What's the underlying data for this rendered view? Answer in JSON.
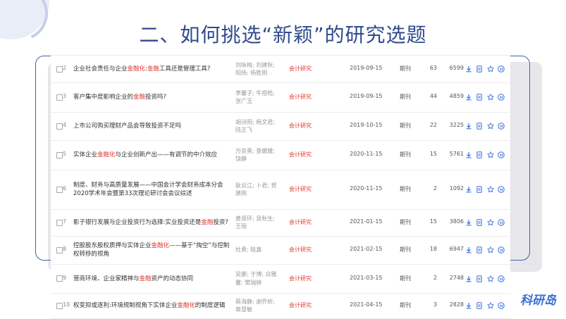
{
  "title": "二、如何挑选“新颖”的研究选题",
  "logo": "科研岛",
  "rows": [
    {
      "num": "2",
      "title_segments": [
        {
          "t": "企业社会责任与企业",
          "h": false
        },
        {
          "t": "金融化",
          "h": true
        },
        {
          "t": ":",
          "h": false
        },
        {
          "t": "金融",
          "h": true
        },
        {
          "t": "工具还是管理工具?",
          "h": false
        }
      ],
      "authors": "刘咏梅; 刘建秋; 阳扬; 杨胜刚",
      "source": "会计研究",
      "date": "2019-09-15",
      "type": "期刊",
      "cites": "63",
      "downloads": "6599"
    },
    {
      "num": "3",
      "title_segments": [
        {
          "t": "客户集中度影响企业的",
          "h": false
        },
        {
          "t": "金融",
          "h": true
        },
        {
          "t": "投资吗?",
          "h": false
        }
      ],
      "authors": "李馨子; 牛煜皓; 张广玉",
      "source": "会计研究",
      "date": "2019-09-15",
      "type": "期刊",
      "cites": "44",
      "downloads": "4859"
    },
    {
      "num": "4",
      "title_segments": [
        {
          "t": "上市公司购买理财产品会导致投资不足吗",
          "h": false
        }
      ],
      "authors": "胡诗阳; 杨文君; 陆正飞",
      "source": "会计研究",
      "date": "2019-10-15",
      "type": "期刊",
      "cites": "22",
      "downloads": "3225"
    },
    {
      "num": "5",
      "title_segments": [
        {
          "t": "实体企业",
          "h": false
        },
        {
          "t": "金融化",
          "h": true
        },
        {
          "t": "与企业创新产出——有调节的中介效应",
          "h": false
        }
      ],
      "authors": "万良勇; 查媛媛; 饶静",
      "source": "会计研究",
      "date": "2020-11-15",
      "type": "期刊",
      "cites": "15",
      "downloads": "5761"
    },
    {
      "num": "6",
      "title_segments": [
        {
          "t": "制度、财务与高质量发展——中国会计学会财务成本分会2020学术年会暨第33次理论研讨会会议综述",
          "h": false
        }
      ],
      "authors": "耿云江; 卜君; 贺建刚",
      "source": "会计研究",
      "date": "2020-11-15",
      "type": "期刊",
      "cites": "2",
      "downloads": "1092"
    },
    {
      "num": "7",
      "title_segments": [
        {
          "t": "影子银行发展与企业投资行为选择:实业投资还是",
          "h": false
        },
        {
          "t": "金融",
          "h": true
        },
        {
          "t": "投资?",
          "h": false
        }
      ],
      "authors": "黄贤环; 吴秋生; 王瑶",
      "source": "会计研究",
      "date": "2021-01-15",
      "type": "期刊",
      "cites": "15",
      "downloads": "3806"
    },
    {
      "num": "8",
      "title_segments": [
        {
          "t": "控股股东股权质押与实体企业",
          "h": false
        },
        {
          "t": "金融化",
          "h": true
        },
        {
          "t": "——基于“掏空”与控制权转移的视角",
          "h": false
        }
      ],
      "authors": "杜勇; 眭鑫",
      "source": "会计研究",
      "date": "2021-02-15",
      "type": "期刊",
      "cites": "18",
      "downloads": "6947"
    },
    {
      "num": "9",
      "title_segments": [
        {
          "t": "营商环境、企业家精神与",
          "h": false
        },
        {
          "t": "金融",
          "h": true
        },
        {
          "t": "资产的动态协同",
          "h": false
        }
      ],
      "authors": "吴娜; 于博; 白雅馨; 樊瑞婷",
      "source": "会计研究",
      "date": "2021-03-15",
      "type": "期刊",
      "cites": "2",
      "downloads": "2748"
    },
    {
      "num": "10",
      "title_segments": [
        {
          "t": "权变抑或逐利:环境规制视角下实体企业",
          "h": false
        },
        {
          "t": "金融化",
          "h": true
        },
        {
          "t": "的制度逻辑",
          "h": false
        }
      ],
      "authors": "蔡海静; 谢乔昕; 章慧敏",
      "source": "会计研究",
      "date": "2021-04-15",
      "type": "期刊",
      "cites": "3",
      "downloads": "2828"
    }
  ],
  "colors": {
    "title": "#2f4a8c",
    "highlight": "#e0322c",
    "source": "#e03a2f",
    "icon": "#3b6fd8",
    "logo": "#3a6fd6"
  }
}
